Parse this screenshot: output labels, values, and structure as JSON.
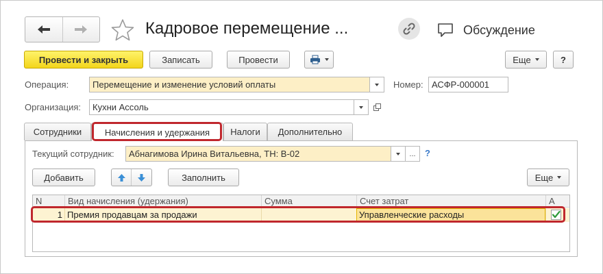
{
  "header": {
    "title": "Кадровое перемещение ...",
    "discussion_label": "Обсуждение"
  },
  "toolbar": {
    "post_and_close": "Провести и закрыть",
    "save": "Записать",
    "post": "Провести",
    "more": "Еще",
    "help": "?"
  },
  "form": {
    "operation_label": "Операция:",
    "operation_value": "Перемещение и изменение условий оплаты",
    "number_label": "Номер:",
    "number_value": "АСФР-000001",
    "organization_label": "Организация:",
    "organization_value": "Кухни Ассоль"
  },
  "tabs": [
    {
      "label": "Сотрудники"
    },
    {
      "label": "Начисления и удержания"
    },
    {
      "label": "Налоги"
    },
    {
      "label": "Дополнительно"
    }
  ],
  "panel": {
    "current_employee_label": "Текущий сотрудник:",
    "current_employee_value": "Абнагимова Ирина Витальевна, ТН: В-02",
    "ellipsis": "...",
    "help": "?",
    "add_button": "Добавить",
    "fill_button": "Заполнить",
    "more_button": "Еще"
  },
  "table": {
    "columns": [
      "N",
      "Вид начисления (удержания)",
      "Сумма",
      "Счет затрат",
      "А"
    ],
    "rows": [
      {
        "n": "1",
        "kind": "Премия продавцам за продажи",
        "sum": "",
        "account": "Управленческие расходы",
        "checked": true
      }
    ]
  },
  "colors": {
    "primary_button": "#f3d51b",
    "highlight_outline": "#c0272d",
    "selected_row": "#fdf3d2",
    "required_field": "#fdefc6"
  }
}
